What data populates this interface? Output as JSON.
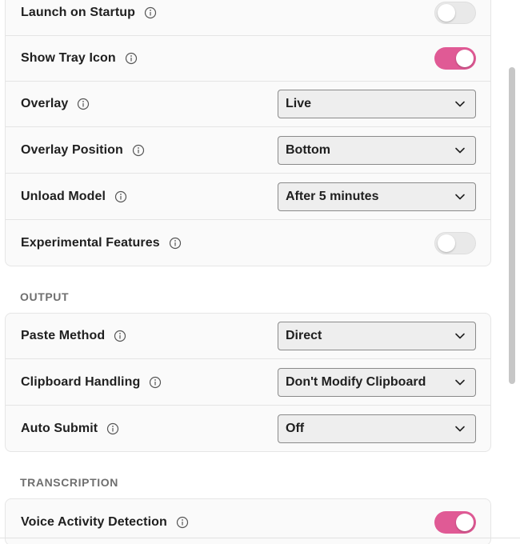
{
  "general": {
    "rows": [
      {
        "label": "Launch on Startup",
        "control": "toggle",
        "on": false
      },
      {
        "label": "Show Tray Icon",
        "control": "toggle",
        "on": true
      },
      {
        "label": "Overlay",
        "control": "select",
        "value": "Live"
      },
      {
        "label": "Overlay Position",
        "control": "select",
        "value": "Bottom"
      },
      {
        "label": "Unload Model",
        "control": "select",
        "value": "After 5 minutes"
      },
      {
        "label": "Experimental Features",
        "control": "toggle",
        "on": false
      }
    ]
  },
  "output": {
    "title": "OUTPUT",
    "rows": [
      {
        "label": "Paste Method",
        "control": "select",
        "value": "Direct"
      },
      {
        "label": "Clipboard Handling",
        "control": "select",
        "value": "Don't Modify Clipboard"
      },
      {
        "label": "Auto Submit",
        "control": "select",
        "value": "Off"
      }
    ]
  },
  "transcription": {
    "title": "TRANSCRIPTION",
    "rows": [
      {
        "label": "Voice Activity Detection",
        "control": "toggle",
        "on": true
      }
    ]
  },
  "colors": {
    "toggle_on": "#e05a95",
    "toggle_off": "#e9e9e9",
    "card_bg": "#fafafa",
    "select_bg": "#eeeeee"
  },
  "icons": {
    "info": "info-circle-icon",
    "chevron": "chevron-down-icon"
  }
}
